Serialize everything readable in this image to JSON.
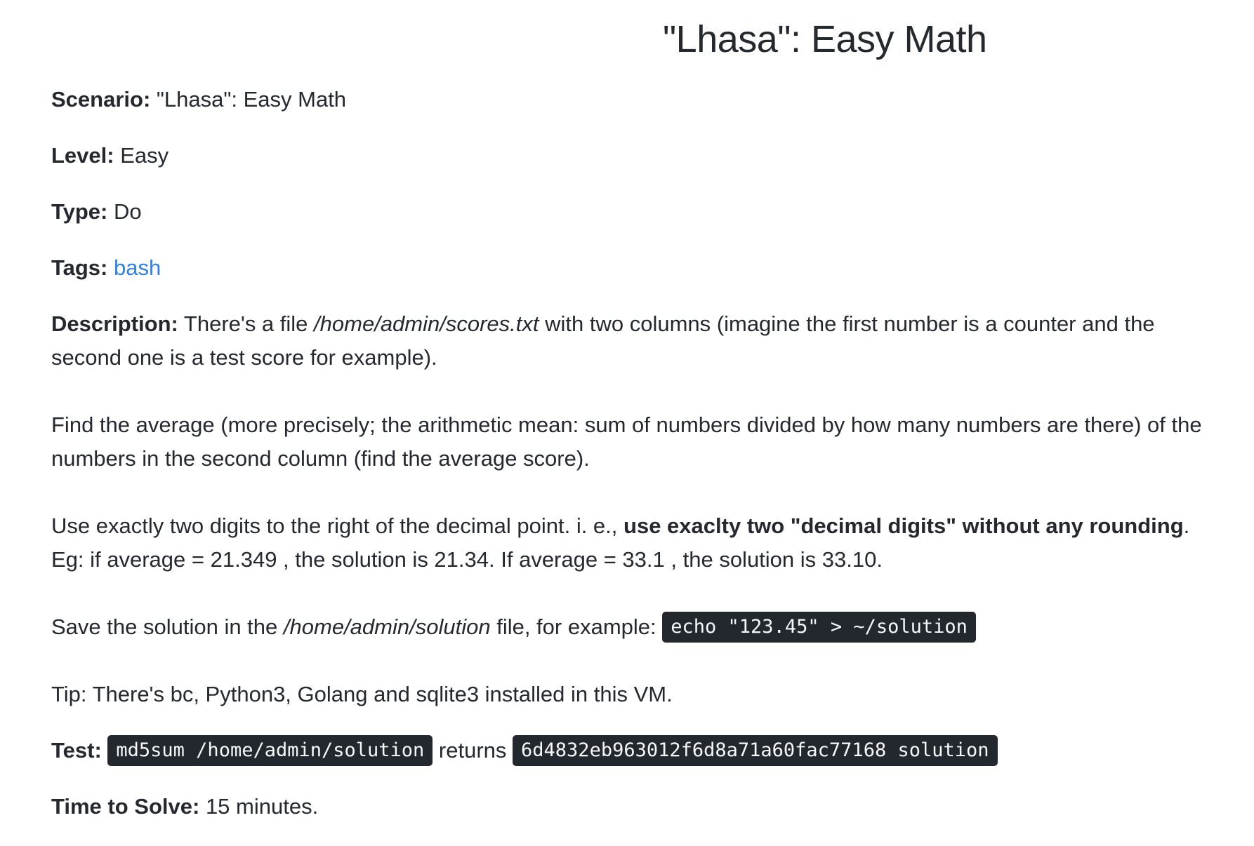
{
  "title": "\"Lhasa\": Easy Math",
  "scenario": {
    "label": "Scenario:",
    "value": "\"Lhasa\": Easy Math"
  },
  "level": {
    "label": "Level:",
    "value": "Easy"
  },
  "type": {
    "label": "Type:",
    "value": "Do"
  },
  "tags": {
    "label": "Tags:",
    "link": "bash"
  },
  "description": {
    "label": "Description:",
    "text_before": "There's a file",
    "file_path": "/home/admin/scores.txt",
    "text_after": "with two columns (imagine the first number is a counter and the second one is a test score for example)."
  },
  "paragraph_find": "Find the average (more precisely; the arithmetic mean: sum of numbers divided by how many numbers are there) of the numbers in the second column (find the average score).",
  "paragraph_use": {
    "text_before": "Use exactly two digits to the right of the decimal point. i. e.,",
    "bold_text": "use exaclty two \"decimal digits\" without any rounding",
    "text_after": ". Eg: if average = 21.349 , the solution is 21.34. If average = 33.1 , the solution is 33.10."
  },
  "paragraph_save": {
    "text_before": "Save the solution in the",
    "file_path": "/home/admin/solution",
    "text_after": "file, for example:",
    "code": "echo \"123.45\" > ~/solution"
  },
  "tip": "Tip: There's bc, Python3, Golang and sqlite3 installed in this VM.",
  "test": {
    "label": "Test:",
    "command": "md5sum /home/admin/solution",
    "middle_text": "returns",
    "expected": "6d4832eb963012f6d8a71a60fac77168 solution"
  },
  "time_to_solve": {
    "label": "Time to Solve:",
    "value": "15 minutes."
  },
  "colors": {
    "text": "#24292f",
    "link": "#2f7fe8",
    "code_background": "#23282e",
    "code_text": "#f6f8fa"
  }
}
